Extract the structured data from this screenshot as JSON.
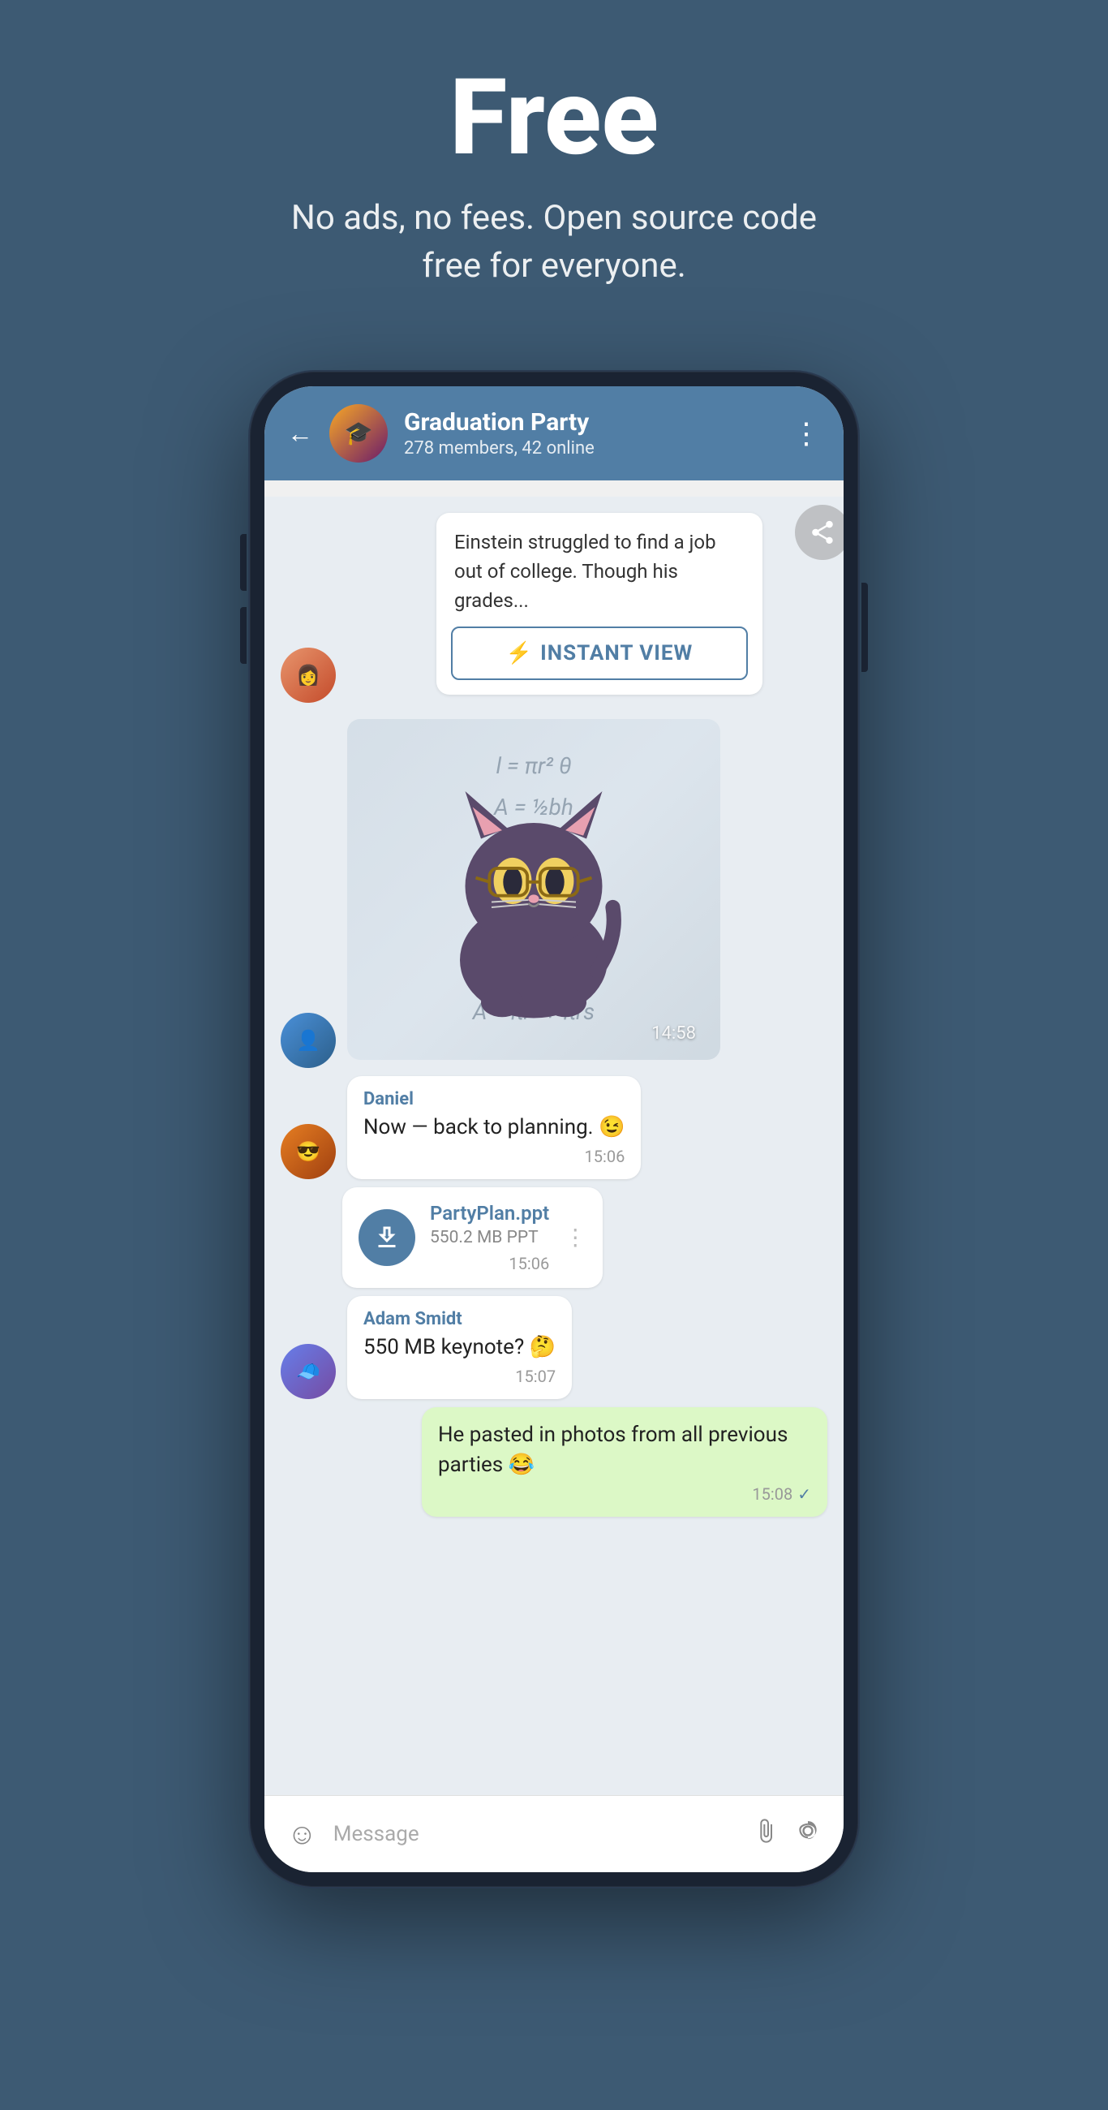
{
  "hero": {
    "title": "Free",
    "subtitle": "No ads, no fees. Open source code free for everyone."
  },
  "phone": {
    "header": {
      "chat_name": "Graduation Party",
      "chat_members": "278 members, 42 online",
      "back_label": "←",
      "menu_label": "⋮"
    },
    "messages": [
      {
        "id": "article",
        "type": "article",
        "text": "Einstein struggled to find a job out of college. Though his grades...",
        "instant_view_label": "INSTANT VIEW"
      },
      {
        "id": "sticker",
        "type": "sticker",
        "time": "14:58"
      },
      {
        "id": "daniel-msg",
        "type": "received",
        "sender": "Daniel",
        "text": "Now — back to planning. 😉",
        "time": "15:06"
      },
      {
        "id": "file-msg",
        "type": "file",
        "file_name": "PartyPlan.ppt",
        "file_size": "550.2 MB PPT",
        "time": "15:06"
      },
      {
        "id": "adam-msg",
        "type": "received",
        "sender": "Adam Smidt",
        "text": "550 MB keynote? 🤔",
        "time": "15:07"
      },
      {
        "id": "own-msg",
        "type": "sent",
        "text": "He pasted in photos from all previous parties 😂",
        "time": "15:08",
        "read": true
      }
    ],
    "input": {
      "placeholder": "Message",
      "emoji_label": "☺",
      "attach_label": "📎",
      "camera_label": "⊙"
    }
  },
  "colors": {
    "header_bg": "#517ea5",
    "chat_bg": "#e8edf2",
    "own_bubble": "#dcf8c6",
    "accent": "#517ea5",
    "background": "#3d5a73"
  }
}
